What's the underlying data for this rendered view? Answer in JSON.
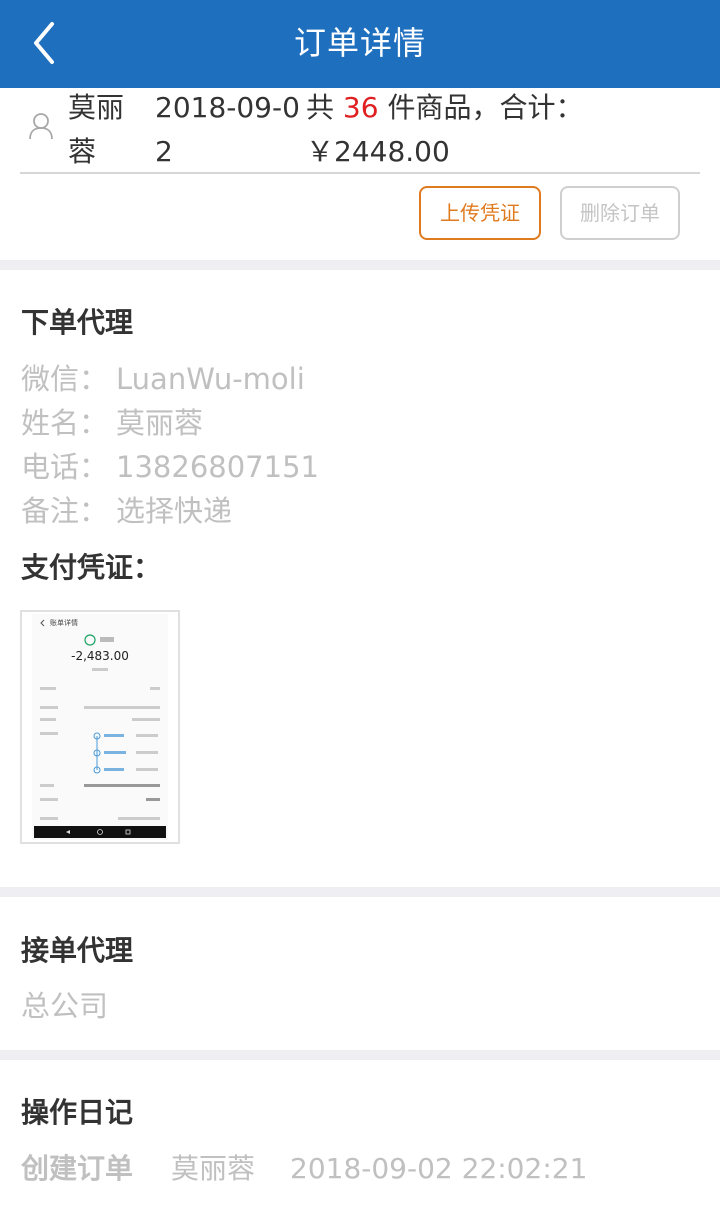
{
  "header": {
    "title": "订单详情",
    "back_icon": "chevron-left-icon",
    "bg_color": "#1f6fbf"
  },
  "order": {
    "user_icon": "user-icon",
    "agent_name": "莫丽蓉",
    "date": "2018-09-02",
    "summary_prefix": "共",
    "quantity": "36",
    "summary_suffix": "件商品，合计：",
    "total": "￥2448.00",
    "quantity_color": "#e02020"
  },
  "actions": {
    "upload_label": "上传凭证",
    "delete_label": "删除订单",
    "upload_color": "#e07a1f"
  },
  "ordering_agent": {
    "title": "下单代理",
    "wechat_label": "微信：",
    "wechat_value": "LuanWu-moli",
    "name_label": "姓名：",
    "name_value": "莫丽蓉",
    "phone_label": "电话：",
    "phone_value": "13826807151",
    "note_label": "备注：",
    "note_value": "选择快递",
    "proof_title": "支付凭证："
  },
  "proof_image": {
    "header": "账单详情",
    "amount": "-2,483.00"
  },
  "receiving_agent": {
    "title": "接单代理",
    "value": "总公司"
  },
  "log": {
    "title": "操作日记",
    "action": "创建订单",
    "user": "莫丽蓉",
    "time": "2018-09-02 22:02:21"
  }
}
